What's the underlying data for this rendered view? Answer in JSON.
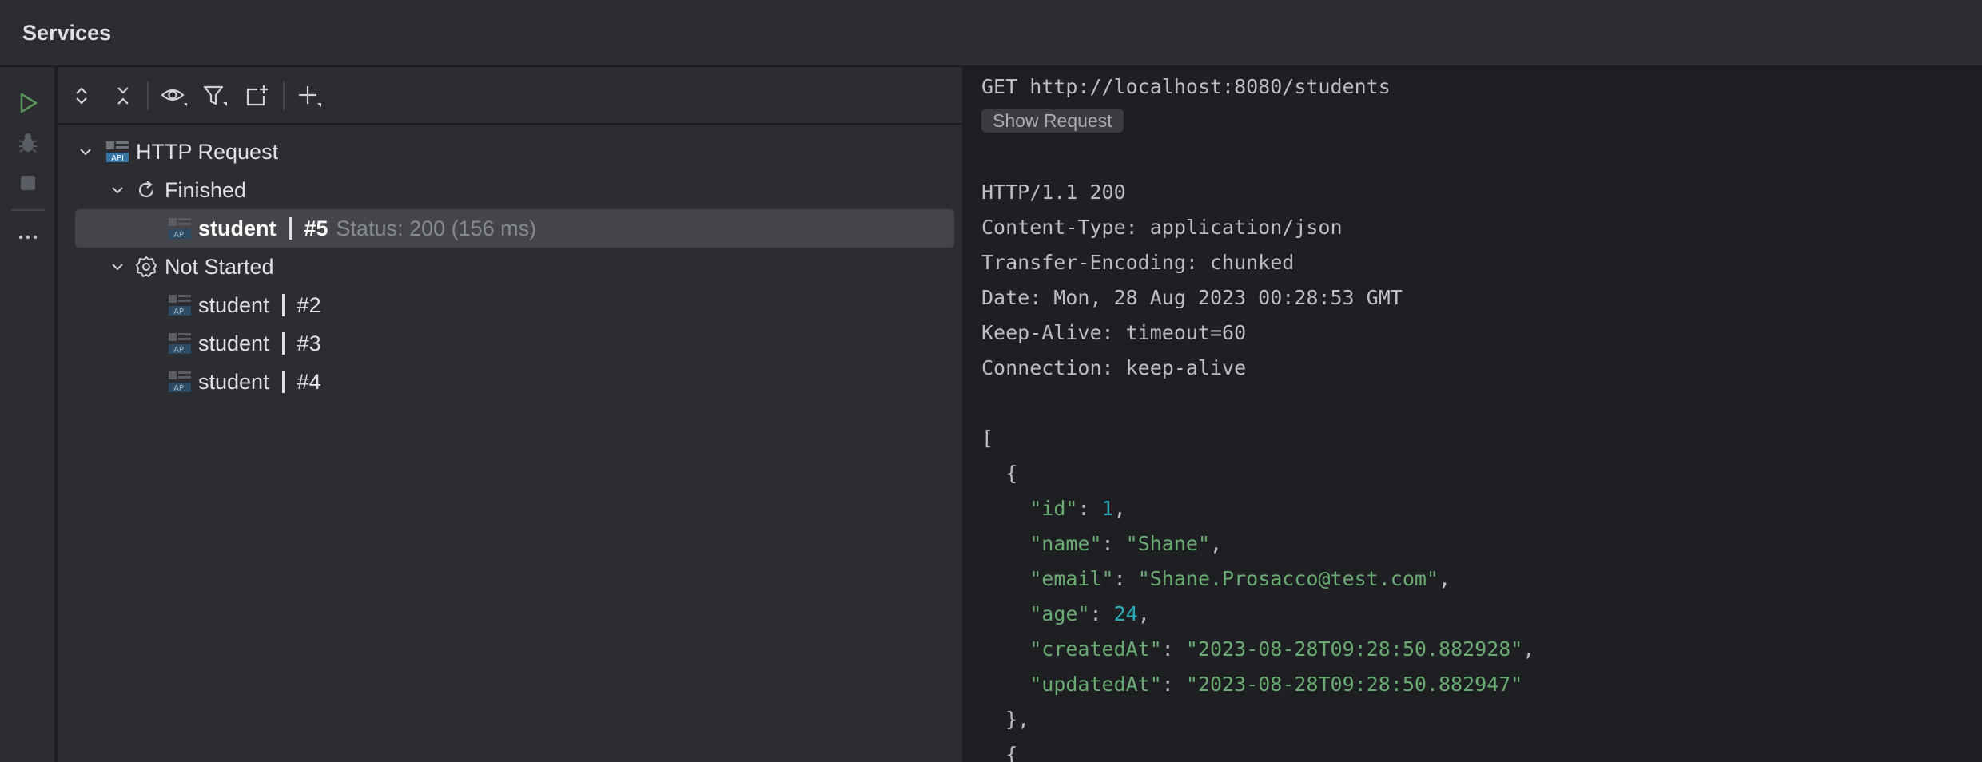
{
  "window": {
    "title": "Services"
  },
  "sidebar": {
    "buttons": [
      {
        "name": "run-icon",
        "color": "#57965c"
      },
      {
        "name": "debug-icon",
        "color": "#6f737a"
      },
      {
        "name": "stop-icon",
        "color": "#6f737a"
      },
      {
        "name": "more-icon",
        "label": "⋯"
      }
    ]
  },
  "toolbar": {
    "buttons": [
      "expand-all-icon",
      "collapse-all-icon",
      "eye-icon",
      "filter-icon",
      "new-tab-icon",
      "add-icon"
    ]
  },
  "tree": {
    "root": {
      "label": "HTTP Request"
    },
    "groups": [
      {
        "label": "Finished",
        "items": [
          {
            "name": "student",
            "number": "#5",
            "status": "Status: 200 (156 ms)"
          }
        ]
      },
      {
        "label": "Not Started",
        "items": [
          {
            "name": "student",
            "number": "#2"
          },
          {
            "name": "student",
            "number": "#3"
          },
          {
            "name": "student",
            "number": "#4"
          }
        ]
      }
    ]
  },
  "response": {
    "request_line": "GET http://localhost:8080/students",
    "show_request_label": "Show Request",
    "status_line": "HTTP/1.1 200",
    "headers": [
      "Content-Type: application/json",
      "Transfer-Encoding: chunked",
      "Date: Mon, 28 Aug 2023 00:28:53 GMT",
      "Keep-Alive: timeout=60",
      "Connection: keep-alive"
    ],
    "body": {
      "open_bracket": "[",
      "open_brace": "  {",
      "fields": [
        {
          "key": "\"id\"",
          "value": "1",
          "type": "number",
          "trail": ","
        },
        {
          "key": "\"name\"",
          "value": "\"Shane\"",
          "type": "string",
          "trail": ","
        },
        {
          "key": "\"email\"",
          "value": "\"Shane.Prosacco@test.com\"",
          "type": "string",
          "trail": ","
        },
        {
          "key": "\"age\"",
          "value": "24",
          "type": "number",
          "trail": ","
        },
        {
          "key": "\"createdAt\"",
          "value": "\"2023-08-28T09:28:50.882928\"",
          "type": "string",
          "trail": ","
        },
        {
          "key": "\"updatedAt\"",
          "value": "\"2023-08-28T09:28:50.882947\"",
          "type": "string",
          "trail": ""
        }
      ],
      "close_brace": "  },",
      "next_brace": "  {"
    }
  }
}
